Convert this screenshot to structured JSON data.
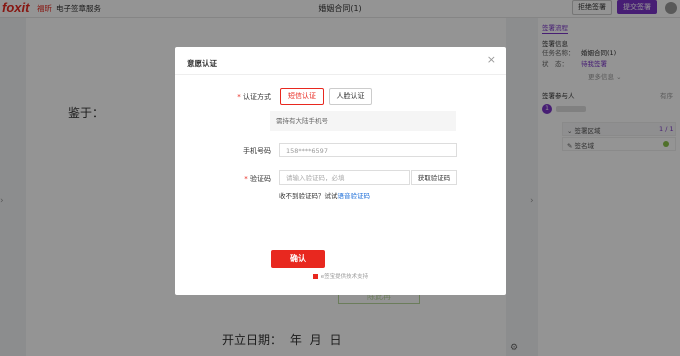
{
  "header": {
    "logo": "foxit",
    "brand_cn": "福昕",
    "service": "电子签章服务",
    "doc_title": "婚姻合同(1)",
    "reject_label": "拒绝签署",
    "submit_label": "提交签署"
  },
  "document": {
    "text_1": "鉴于：",
    "date_label": "开立日期：    年    月    日",
    "sig_box": "除此再"
  },
  "sidebar": {
    "tab": "签署流程",
    "info_title": "签署信息",
    "task_name_label": "任务名称：",
    "task_name": "婚姻合同(1)",
    "status_label": "状　态：",
    "status": "待我签署",
    "more_info": "更多信息",
    "signers_title": "签署参与人",
    "signers_right": "有序",
    "signer_number": "1",
    "sig_area_label": "签署区域",
    "sig_area_count": "1 / 1",
    "sig_field_label": "签名域"
  },
  "modal": {
    "title": "意愿认证",
    "method_label": "认证方式",
    "opt_sms": "短信认证",
    "opt_face": "人脸认证",
    "hint": "需持有大陆手机号",
    "phone_label": "手机号码",
    "phone_value": "158****6597",
    "code_label": "验证码",
    "code_placeholder": "请输入验证码，必填",
    "get_code": "获取验证码",
    "no_code_text": "收不到验证码？试试",
    "voice_code": "语音验证码",
    "confirm": "确认",
    "footer": "e签宝提供技术支持"
  },
  "colors": {
    "accent_red": "#e8281f",
    "accent_purple": "#7b35c9"
  }
}
